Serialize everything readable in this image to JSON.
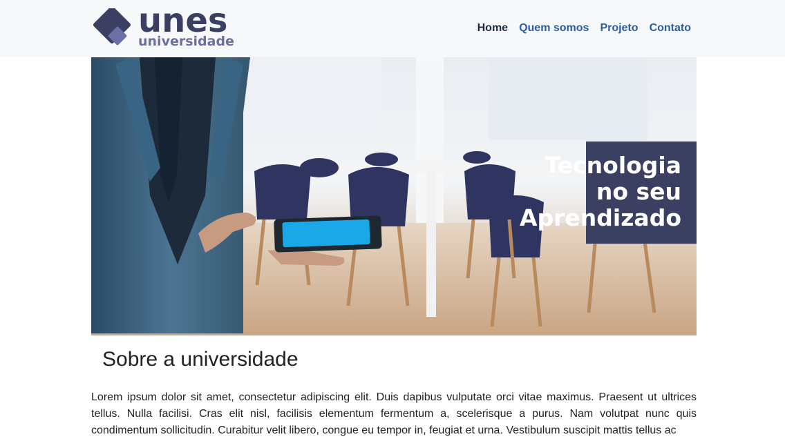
{
  "brand": {
    "name": "unes",
    "subtitle": "universidade",
    "colors": {
      "dark": "#3b4063",
      "light": "#6b6fa6"
    }
  },
  "nav": {
    "items": [
      {
        "label": "Home",
        "active": true
      },
      {
        "label": "Quem somos",
        "active": false
      },
      {
        "label": "Projeto",
        "active": false
      },
      {
        "label": "Contato",
        "active": false
      }
    ]
  },
  "hero": {
    "caption_lines": [
      "Tecnologia",
      "no seu",
      "Aprendizado"
    ],
    "colors": {
      "caption_bg": "#3b4063",
      "tablet_screen": "#1aa8e8"
    }
  },
  "section": {
    "title": "Sobre a universidade",
    "body": "Lorem ipsum dolor sit amet, consectetur adipiscing elit. Duis dapibus vulputate orci vitae maximus. Praesent ut ultrices tellus. Nulla facilisi. Cras elit nisl, facilisis elementum fermentum a, scelerisque a purus. Nam volutpat nunc quis condimentum sollicitudin. Curabitur velit libero, congue eu tempor in, feugiat et urna. Vestibulum suscipit mattis tellus ac"
  }
}
